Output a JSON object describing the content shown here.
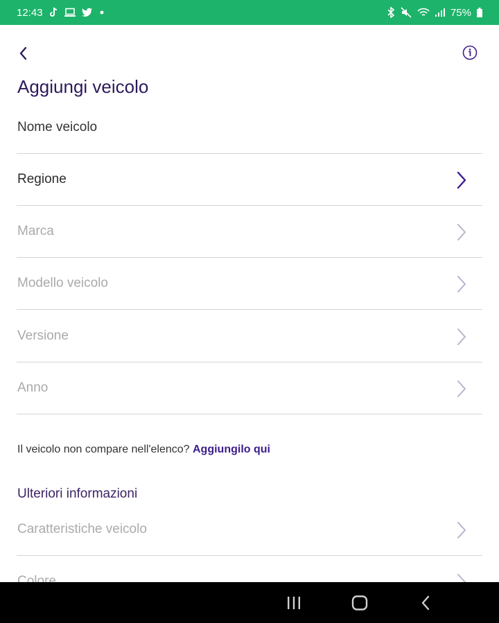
{
  "status_bar": {
    "time": "12:43",
    "battery": "75%",
    "notification_icons": [
      "tiktok-icon",
      "laptop-icon",
      "twitter-icon",
      "dot-icon"
    ],
    "system_icons": [
      "bluetooth-icon",
      "mute-icon",
      "wifi-icon",
      "signal-icon",
      "battery-icon"
    ],
    "background_color": "#1db36a"
  },
  "header": {
    "back_icon": "chevron-left-icon",
    "info_icon": "info-circle-icon",
    "title": "Aggiungi veicolo"
  },
  "form": {
    "name_field": {
      "label": "Nome veicolo"
    },
    "rows": [
      {
        "label": "Regione",
        "state": "active"
      },
      {
        "label": "Marca",
        "state": "disabled"
      },
      {
        "label": "Modello veicolo",
        "state": "disabled"
      },
      {
        "label": "Versione",
        "state": "disabled"
      },
      {
        "label": "Anno",
        "state": "disabled"
      }
    ]
  },
  "hint": {
    "text": "Il veicolo non compare nell'elenco?",
    "link_label": "Aggiungilo qui"
  },
  "more_info": {
    "title": "Ulteriori informazioni",
    "rows": [
      {
        "label": "Caratteristiche veicolo",
        "state": "disabled"
      },
      {
        "label": "Colore",
        "state": "disabled"
      }
    ]
  },
  "nav_bar": {
    "buttons": [
      "recent-apps-icon",
      "home-icon",
      "back-icon"
    ]
  },
  "colors": {
    "accent": "#3d1d8c",
    "title": "#2d1a5b",
    "divider": "#d5d5d5",
    "disabled_text": "#aaaaaa",
    "disabled_chevron": "#b9b3cc"
  }
}
